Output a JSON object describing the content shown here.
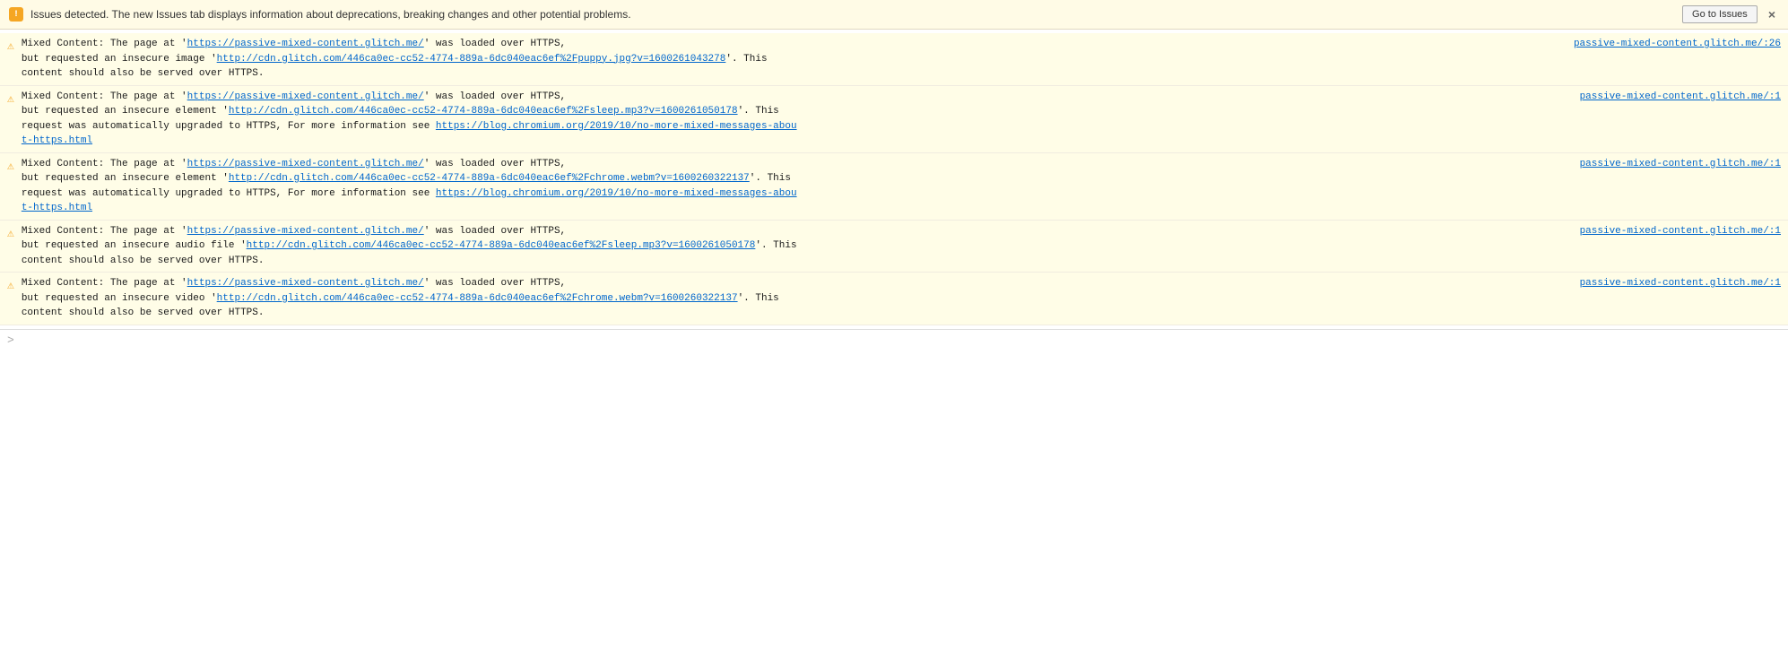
{
  "banner": {
    "icon": "!",
    "text": "Issues detected. The new Issues tab displays information about deprecations, breaking changes and other potential problems.",
    "button_label": "Go to Issues",
    "close_label": "×"
  },
  "messages": [
    {
      "id": "msg1",
      "source_link": "passive-mixed-content.glitch.me/:26",
      "source_href": "passive-mixed-content.glitch.me/:26",
      "text_before": "Mixed Content: The page at '",
      "page_url": "https://passive-mixed-content.glitch.me/",
      "text_middle": "' was loaded over HTTPS,",
      "text_line2_before": "but requested an insecure image '",
      "resource_url": "http://cdn.glitch.com/446ca0ec-cc52-4774-889a-6dc040eac6ef%2Fpuppy.jpg?v=1600261043278",
      "text_line2_after": "'. This",
      "text_line3": "content should also be served over HTTPS."
    },
    {
      "id": "msg2",
      "source_link": "passive-mixed-content.glitch.me/:1",
      "source_href": "passive-mixed-content.glitch.me/:1",
      "text_before": "Mixed Content: The page at '",
      "page_url": "https://passive-mixed-content.glitch.me/",
      "text_middle": "' was loaded over HTTPS,",
      "text_line2_before": "but requested an insecure element '",
      "resource_url": "http://cdn.glitch.com/446ca0ec-cc52-4774-889a-6dc040eac6ef%2Fsleep.mp3?v=1600261050178",
      "text_line2_after": "'. This",
      "text_line3_before": "request was automatically upgraded to HTTPS, For more information see ",
      "blog_url": "https://blog.chromium.org/2019/10/no-more-mixed-messages-about-https.html",
      "blog_url_text": "https://blog.chromium.org/2019/10/no-more-mixed-messages-abou",
      "blog_url_text2": "t-https.html",
      "type": "upgraded"
    },
    {
      "id": "msg3",
      "source_link": "passive-mixed-content.glitch.me/:1",
      "source_href": "passive-mixed-content.glitch.me/:1",
      "text_before": "Mixed Content: The page at '",
      "page_url": "https://passive-mixed-content.glitch.me/",
      "text_middle": "' was loaded over HTTPS,",
      "text_line2_before": "but requested an insecure element '",
      "resource_url": "http://cdn.glitch.com/446ca0ec-cc52-4774-889a-6dc040eac6ef%2Fchrome.webm?v=1600260322137",
      "text_line2_after": "'. This",
      "text_line3_before": "request was automatically upgraded to HTTPS, For more information see ",
      "blog_url": "https://blog.chromium.org/2019/10/no-more-mixed-messages-about-https.html",
      "blog_url_text": "https://blog.chromium.org/2019/10/no-more-mixed-messages-abou",
      "blog_url_text2": "t-https.html",
      "type": "upgraded"
    },
    {
      "id": "msg4",
      "source_link": "passive-mixed-content.glitch.me/:1",
      "source_href": "passive-mixed-content.glitch.me/:1",
      "text_before": "Mixed Content: The page at '",
      "page_url": "https://passive-mixed-content.glitch.me/",
      "text_middle": "' was loaded over HTTPS,",
      "text_line2_before": "but requested an insecure audio file '",
      "resource_url": "http://cdn.glitch.com/446ca0ec-cc52-4774-889a-6dc040eac6ef%2Fsleep.mp3?v=1600261050178",
      "text_line2_after": "'. This",
      "text_line3": "content should also be served over HTTPS.",
      "type": "audio"
    },
    {
      "id": "msg5",
      "source_link": "passive-mixed-content.glitch.me/:1",
      "source_href": "passive-mixed-content.glitch.me/:1",
      "text_before": "Mixed Content: The page at '",
      "page_url": "https://passive-mixed-content.glitch.me/",
      "text_middle": "' was loaded over HTTPS,",
      "text_line2_before": "but requested an insecure video '",
      "resource_url": "http://cdn.glitch.com/446ca0ec-cc52-4774-889a-6dc040eac6ef%2Fchrome.webm?v=1600260322137",
      "text_line2_after": "'. This",
      "text_line3": "content should also be served over HTTPS.",
      "type": "video"
    }
  ],
  "bottom": {
    "prompt": ">"
  }
}
